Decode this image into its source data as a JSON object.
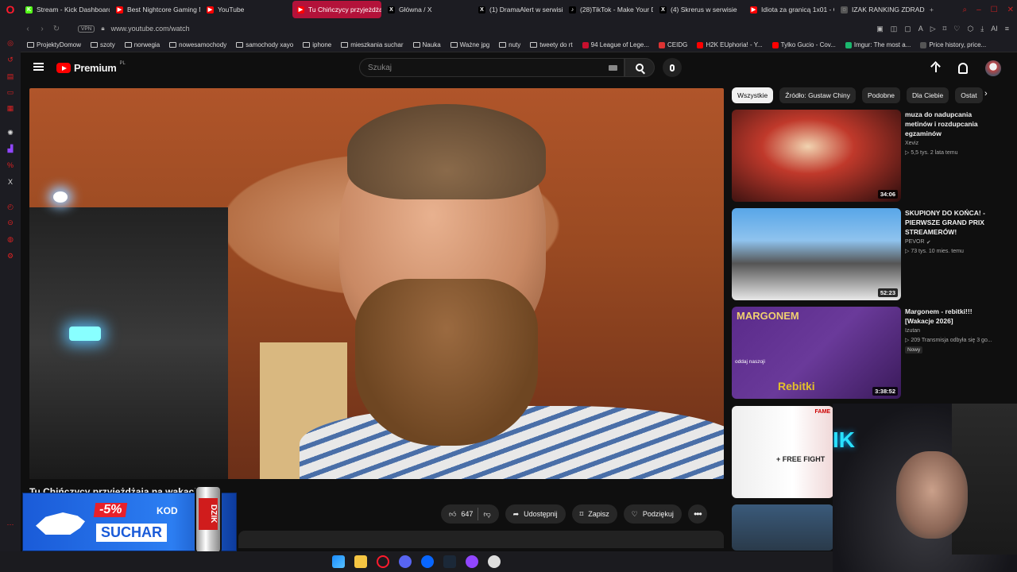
{
  "browser": {
    "tabs": [
      {
        "label": "Stream - Kick Dashboard",
        "color": "#53fc18",
        "glyph": "K",
        "active": false
      },
      {
        "label": "Best Nightcore Gaming M",
        "color": "#ff0000",
        "glyph": "▶",
        "active": false
      },
      {
        "label": "YouTube",
        "color": "#ff0000",
        "glyph": "▶",
        "active": false
      },
      {
        "label": "Tu Chińczycy przyjeżdżają",
        "color": "#ff0000",
        "glyph": "▶",
        "active": true
      },
      {
        "label": "Główna / X",
        "color": "#000000",
        "glyph": "X",
        "active": false
      },
      {
        "label": "(1) DramaAlert w serwisie",
        "color": "#000000",
        "glyph": "X",
        "active": false
      },
      {
        "label": "(28)TikTok - Make Your D",
        "color": "#000000",
        "glyph": "♪",
        "active": false
      },
      {
        "label": "(4) Skrerus w serwisie",
        "color": "#000000",
        "glyph": "X",
        "active": false
      },
      {
        "label": "Idiota za granicą 1x01 - C",
        "color": "#ff0000",
        "glyph": "▶",
        "active": false
      },
      {
        "label": "IZAK RANKING ZDRADZA",
        "color": "#555555",
        "glyph": "◌",
        "active": false
      }
    ],
    "new_tab_label": "+",
    "url": "www.youtube.com/watch",
    "vpn_label": "VPN",
    "ai_label": "AI",
    "bookmarks": [
      {
        "label": "ProjektyDomow",
        "type": "folder"
      },
      {
        "label": "szoty",
        "type": "folder"
      },
      {
        "label": "norwegia",
        "type": "folder"
      },
      {
        "label": "nowesamochody",
        "type": "folder"
      },
      {
        "label": "samochody xayo",
        "type": "folder"
      },
      {
        "label": "iphone",
        "type": "folder"
      },
      {
        "label": "mieszkania suchar",
        "type": "folder"
      },
      {
        "label": "Nauka",
        "type": "folder"
      },
      {
        "label": "Ważne jpg",
        "type": "folder"
      },
      {
        "label": "nuty",
        "type": "folder"
      },
      {
        "label": "tweety do rt",
        "type": "folder"
      },
      {
        "label": "94 League of Lege...",
        "type": "site",
        "color": "#c8102e"
      },
      {
        "label": "CEIDG",
        "type": "site",
        "color": "#d33"
      },
      {
        "label": "H2K EUphoria! - Y...",
        "type": "site",
        "color": "#ff0000"
      },
      {
        "label": "Tylko Gucio - Cov...",
        "type": "site",
        "color": "#ff0000"
      },
      {
        "label": "Imgur: The most a...",
        "type": "site",
        "color": "#1bb76e"
      },
      {
        "label": "Price history, price...",
        "type": "site",
        "color": "#555"
      }
    ]
  },
  "youtube": {
    "brand": "Premium",
    "region": "PL",
    "search_placeholder": "Szukaj",
    "video_title": "Tu Chińczycy przyjeżdżają na wakacje",
    "like_count": "647",
    "share_label": "Udostępnij",
    "save_label": "Zapisz",
    "thanks_label": "Podziękuj",
    "chips": [
      "Wszystkie",
      "Źródło: Gustaw Chiny",
      "Podobne",
      "Dla Ciebie",
      "Ostat"
    ],
    "recommendations": [
      {
        "title": "muza do nadupcania metinów i rozdupcania egzaminów",
        "channel": "Xeviz",
        "views": "5,5 tys.",
        "age": "2 lata temu",
        "duration": "34:06",
        "thumb": "metin"
      },
      {
        "title": "SKUPIONY DO KOŃCA! - PIERWSZE GRAND PRIX STREAMERÓW!",
        "channel": "PEVOR",
        "verified": true,
        "views": "73 tys.",
        "age": "10 mies. temu",
        "duration": "52:23",
        "thumb": "race"
      },
      {
        "title": "Margonem - rebitki!!! [Wakacje 2026]",
        "channel": "Izutan",
        "views": "209",
        "age": "Transmisja odbyła się 3 go...",
        "badge": "Nowy",
        "duration": "3:38:52",
        "thumb": "margonem",
        "thumb_text": "MARGONEM",
        "thumb_sub": "Rebitki",
        "thumb_note": "oddaj naszoji"
      },
      {
        "title": "",
        "thumb": "fame",
        "thumb_text": "FAME",
        "thumb_sub": "+ FREE FIGHT"
      },
      {
        "title": "",
        "thumb": "face"
      }
    ]
  },
  "ad": {
    "discount": "-5%",
    "kod_label": "KOD",
    "code": "SUCHAR",
    "can_brand": "DZIK"
  },
  "webcam": {
    "neon_text": "IK"
  },
  "colors": {
    "accent": "#ff0000",
    "active_tab": "#b3123a",
    "ad_blue": "#2c7ef2",
    "ad_red": "#e8202a"
  }
}
